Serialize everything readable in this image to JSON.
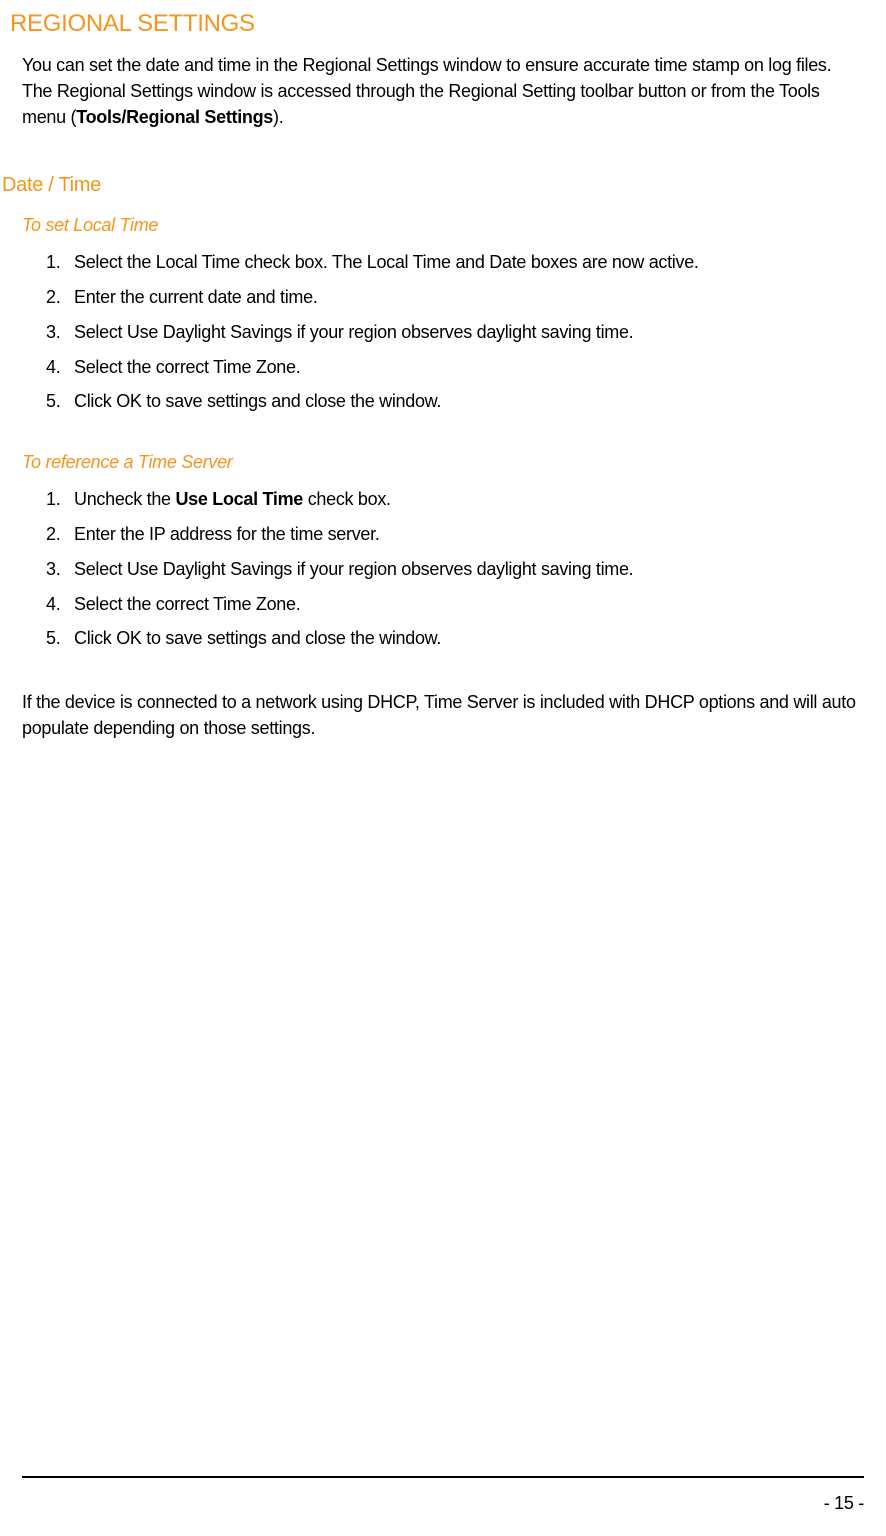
{
  "title": "REGIONAL SETTINGS",
  "intro": {
    "text_before_bold": "You can set the date and time in the Regional Settings window  to ensure accurate time stamp on log files. The Regional Settings window is accessed through the Regional Setting toolbar button or from the Tools menu (",
    "bold": "Tools/Regional Settings",
    "text_after_bold": ")."
  },
  "section_heading": "Date / Time",
  "block1": {
    "heading": "To set Local Time",
    "items": [
      "Select the Local Time check box. The Local Time and Date boxes are now active.",
      "Enter the current date and time.",
      "Select Use Daylight Savings if your region observes daylight saving time.",
      "Select the correct Time Zone.",
      "Click OK to save settings and close the window."
    ]
  },
  "block2": {
    "heading": "To reference a Time Server",
    "item1_before": "Uncheck the ",
    "item1_bold": "Use Local Time",
    "item1_after": " check box.",
    "items_rest": [
      "Enter the IP address for the time server.",
      "Select Use Daylight Savings if your region observes daylight saving time.",
      "Select the correct Time Zone.",
      "Click OK to save settings and close the window."
    ]
  },
  "note": "If the device is connected to a network using DHCP, Time Server is included with DHCP options and will auto populate depending on those settings.",
  "page_number": "- 15 -"
}
